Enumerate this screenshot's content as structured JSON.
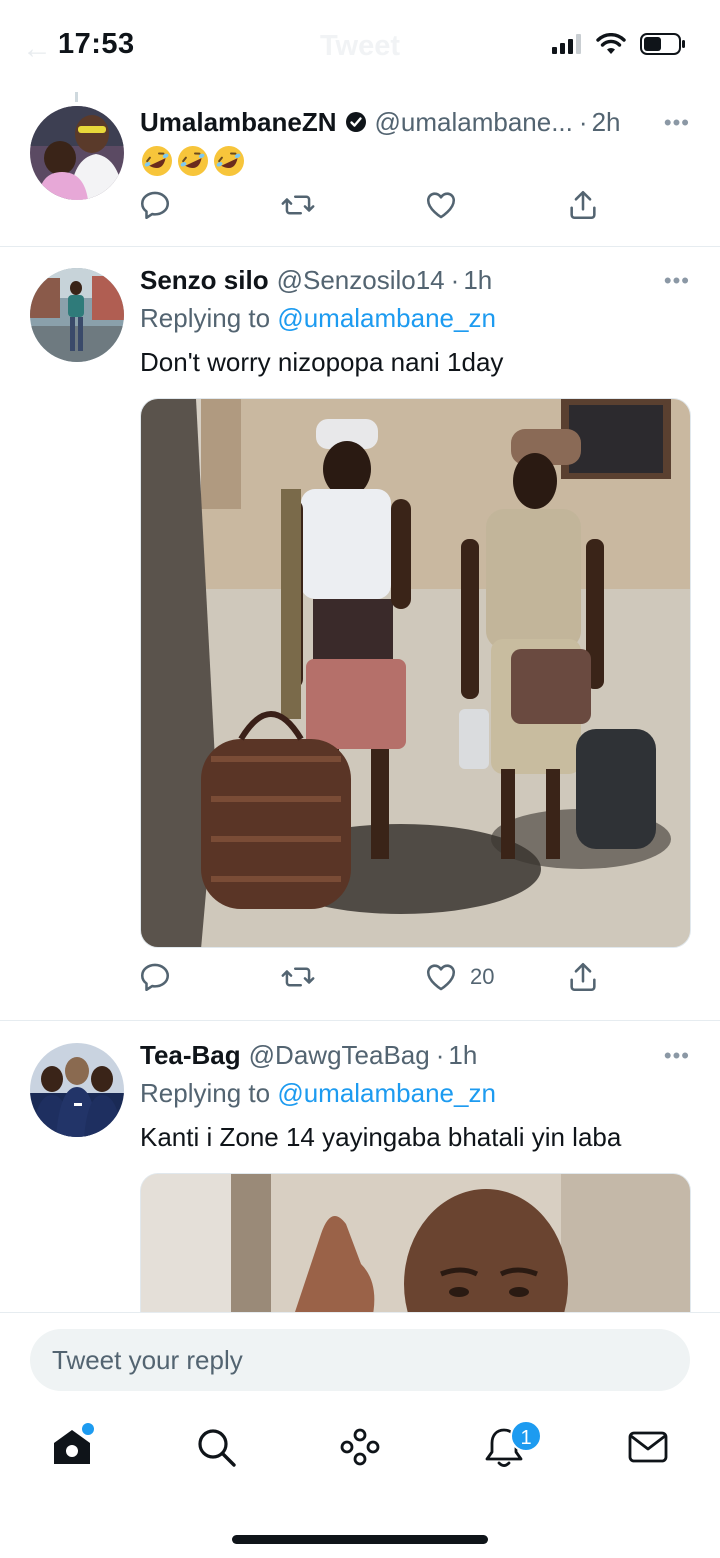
{
  "status_bar": {
    "time": "17:53"
  },
  "header": {
    "title": "Tweet"
  },
  "tweets": [
    {
      "name": "UmalambaneZN",
      "handle": "@umalambane...",
      "time": "2h",
      "text": "🤣🤣🤣",
      "verified": true
    },
    {
      "name": "Senzo silo",
      "handle": "@Senzosilo14",
      "time": "1h",
      "replying_prefix": "Replying to",
      "replying_to": "@umalambane_zn",
      "text": "Don't worry nizopopa nani 1day",
      "like_count": "20"
    },
    {
      "name": "Tea-Bag",
      "handle": "@DawgTeaBag",
      "time": "1h",
      "replying_prefix": "Replying to",
      "replying_to": "@umalambane_zn",
      "text": "Kanti i Zone 14 yayingaba bhatali yin laba"
    }
  ],
  "composer": {
    "placeholder": "Tweet your reply"
  },
  "tab_bar": {
    "notifications_badge": "1"
  },
  "colors": {
    "accent": "#1d9bf0",
    "text": "#0f1419",
    "muted": "#536471"
  }
}
